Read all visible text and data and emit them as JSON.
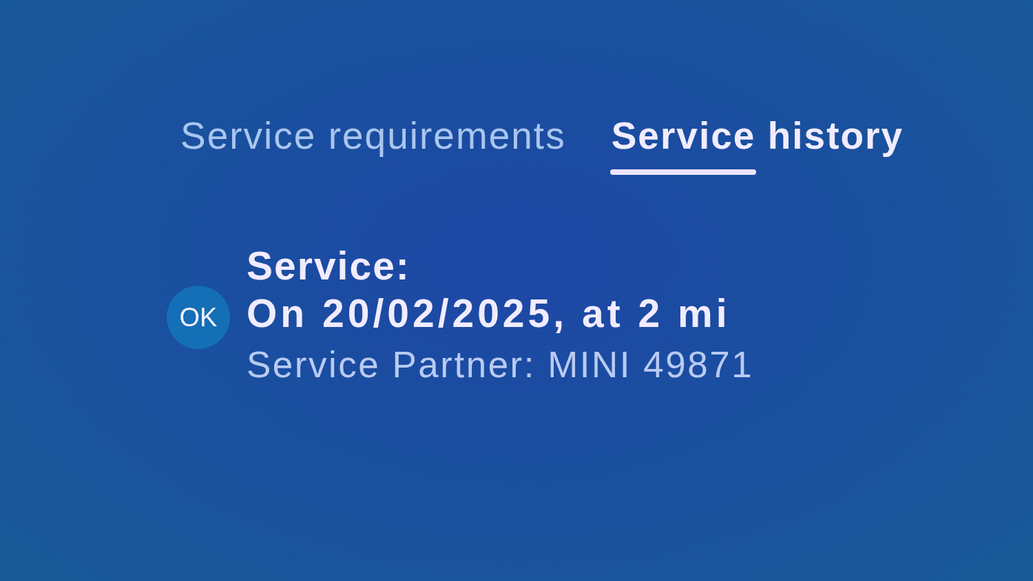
{
  "tabs": [
    {
      "label": "Service requirements",
      "selected": false
    },
    {
      "label": "Service history",
      "selected": true
    }
  ],
  "service": {
    "status": "OK",
    "title": "Service:",
    "detail": "On 20/02/2025, at 2 mi",
    "partner": "Service Partner: MINI 49871"
  }
}
